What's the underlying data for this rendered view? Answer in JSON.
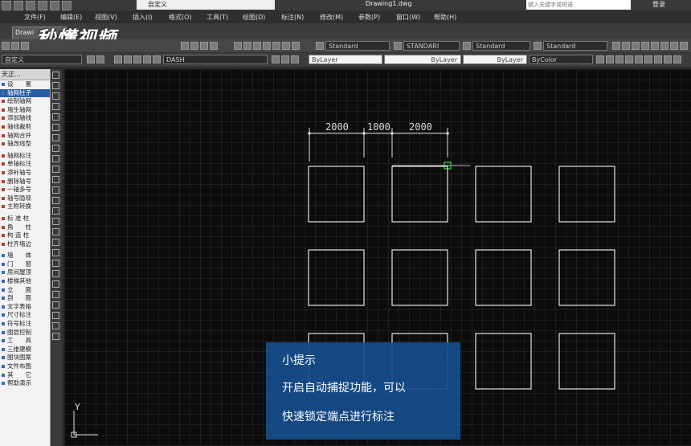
{
  "window": {
    "doc_title": "Drawing1.dwg",
    "workspace": "自定义",
    "search_placeholder": "键入关键字或短语",
    "login": "登录"
  },
  "menu": [
    "文件(F)",
    "编辑(E)",
    "视图(V)",
    "插入(I)",
    "格式(O)",
    "工具(T)",
    "绘图(D)",
    "标注(N)",
    "修改(M)",
    "参数(P)",
    "窗口(W)",
    "帮助(H)"
  ],
  "tab": {
    "label": "Drawi"
  },
  "watermark": "秒懂视频",
  "toolbar": {
    "text_style": "Standard",
    "dim_style": "STANDARI",
    "table_style": "Standard",
    "mleader_style": "Standard",
    "workspace2": "自定义",
    "layer": "DASH",
    "color": "ByLayer",
    "linetype": "ByLayer",
    "lineweight": "ByLayer",
    "plotstyle": "ByColor"
  },
  "panel": {
    "title": "天正...",
    "items": [
      "设　　置",
      "轴网柱子",
      "绘制轴网",
      "墙生轴网",
      "添加轴线",
      "轴线裁剪",
      "轴网合并",
      "轴改线型",
      "轴网标注",
      "单轴标注",
      "添补轴号",
      "删除轴号",
      "一轴多号",
      "轴号隐现",
      "主附转换",
      "标 准 柱",
      "角　　柱",
      "构 造 柱",
      "柱齐墙边",
      "墙　　体",
      "门　　窗",
      "房间屋顶",
      "楼梯其他",
      "立　　面",
      "剖　　面",
      "文字表格",
      "尺寸标注",
      "符号标注",
      "图层控制",
      "工　　具",
      "三维建模",
      "图块图案",
      "文件布图",
      "其　　它",
      "帮助演示"
    ]
  },
  "dimensions": [
    "2000",
    "1000",
    "2000"
  ],
  "axis_label": "Y",
  "tip": {
    "title": "小提示",
    "line1": "开启自动捕捉功能，可以",
    "line2": "快速锁定端点进行标注"
  }
}
